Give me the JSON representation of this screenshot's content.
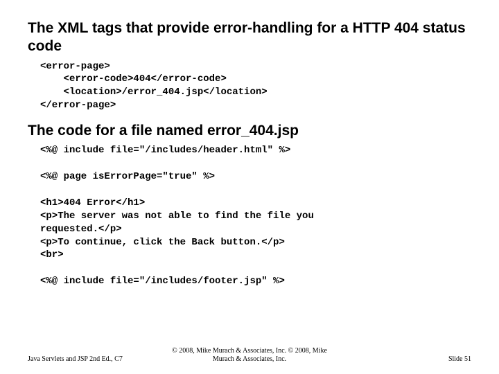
{
  "heading1": "The XML tags that provide error-handling for a HTTP 404 status code",
  "code1": "<error-page>\n    <error-code>404</error-code>\n    <location>/error_404.jsp</location>\n</error-page>",
  "heading2": "The code for a file named error_404.jsp",
  "code2": "<%@ include file=\"/includes/header.html\" %>\n\n<%@ page isErrorPage=\"true\" %>\n\n<h1>404 Error</h1>\n<p>The server was not able to find the file you\nrequested.</p>\n<p>To continue, click the Back button.</p>\n<br>\n\n<%@ include file=\"/includes/footer.jsp\" %>",
  "footer": {
    "left": "Java Servlets and JSP 2nd Ed., C7",
    "center_line1": "© 2008, Mike Murach & Associates, Inc. © 2008, Mike",
    "center_line2": "Murach & Associates, Inc.",
    "right": "Slide 51"
  }
}
